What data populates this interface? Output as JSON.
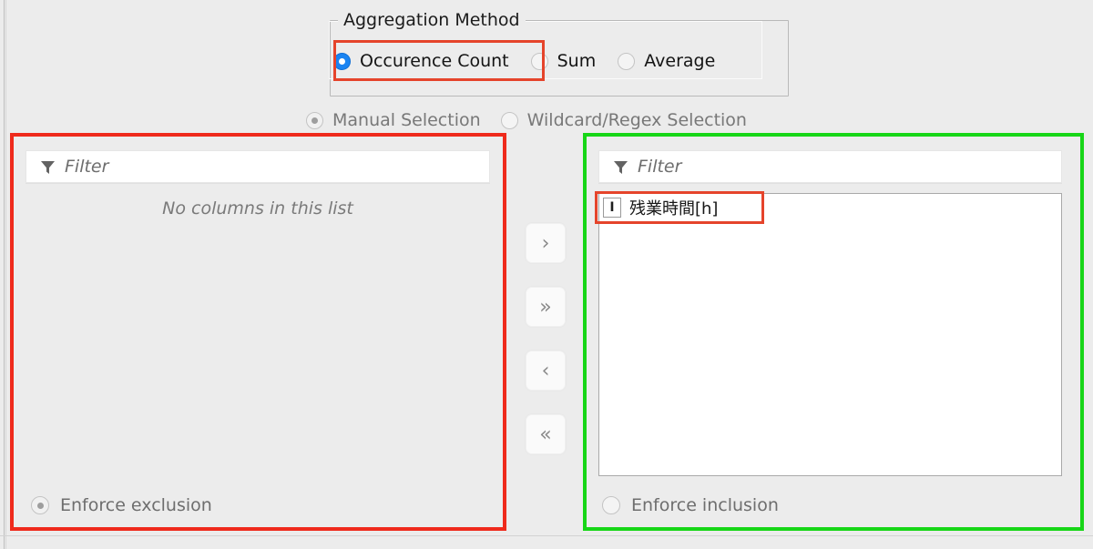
{
  "aggregation": {
    "group_title": "Aggregation Method",
    "options": [
      {
        "label": "Occurence Count",
        "selected": true
      },
      {
        "label": "Sum",
        "selected": false
      },
      {
        "label": "Average",
        "selected": false
      }
    ]
  },
  "selection_mode": {
    "options": [
      {
        "label": "Manual Selection",
        "selected": true
      },
      {
        "label": "Wildcard/Regex Selection",
        "selected": false
      }
    ]
  },
  "left_panel": {
    "filter_placeholder": "Filter",
    "filter_value": "",
    "filter_icon": "funnel-icon",
    "empty_message": "No columns in this list",
    "enforce_label": "Enforce exclusion",
    "enforce_selected": true
  },
  "right_panel": {
    "filter_placeholder": "Filter",
    "filter_value": "",
    "filter_icon": "funnel-icon",
    "items": [
      {
        "label": "残業時間[h]",
        "type_icon": "integer-column-icon",
        "type_glyph": "I"
      }
    ],
    "enforce_label": "Enforce inclusion",
    "enforce_selected": false
  },
  "transfer_buttons": [
    {
      "name": "move-right-button",
      "glyph": "›"
    },
    {
      "name": "move-all-right-button",
      "glyph": "»"
    },
    {
      "name": "move-left-button",
      "glyph": "‹"
    },
    {
      "name": "move-all-left-button",
      "glyph": "«"
    }
  ],
  "annotations": [
    {
      "name": "excluded-columns-highlight",
      "color": "#ef2a1c"
    },
    {
      "name": "included-columns-highlight",
      "color": "#17d617"
    },
    {
      "name": "occurence-count-highlight",
      "color": "#e5442b"
    },
    {
      "name": "selected-column-highlight",
      "color": "#e5442b"
    }
  ]
}
